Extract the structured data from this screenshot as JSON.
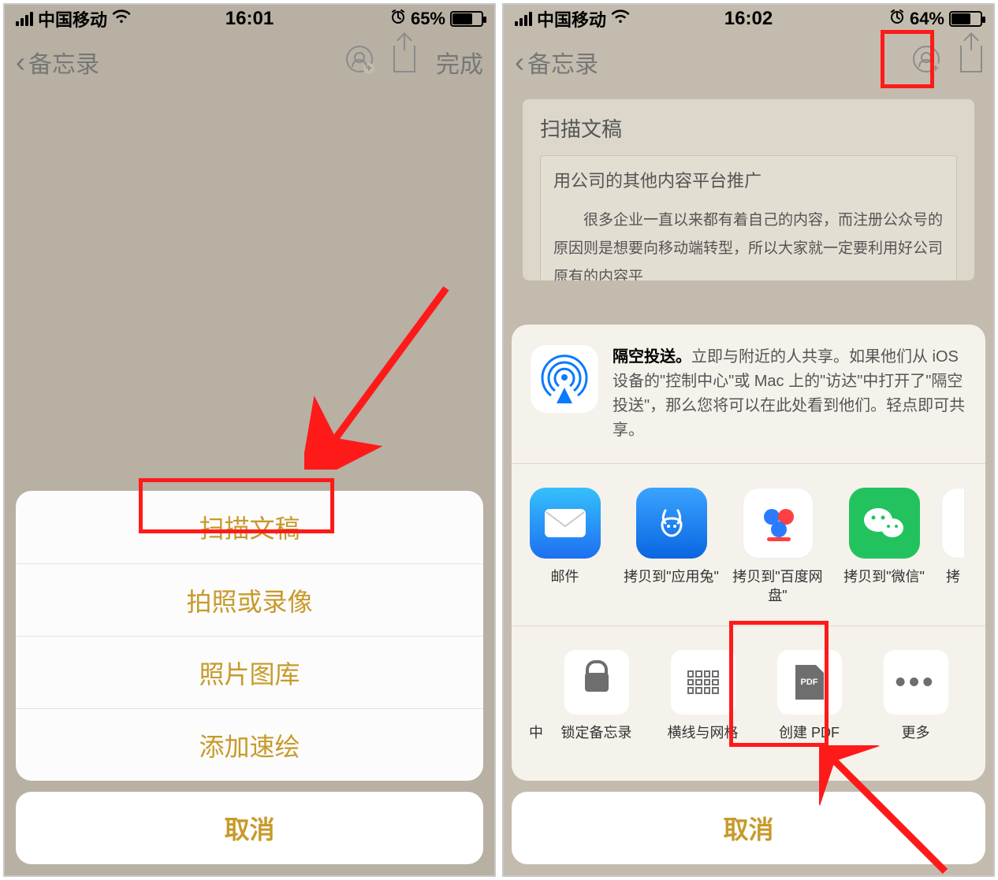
{
  "left": {
    "status": {
      "carrier": "中国移动",
      "time": "16:01",
      "battery_pct": "65%"
    },
    "nav": {
      "back": "备忘录",
      "done": "完成"
    },
    "sheet": {
      "items": [
        "扫描文稿",
        "拍照或录像",
        "照片图库",
        "添加速绘"
      ],
      "cancel": "取消"
    }
  },
  "right": {
    "status": {
      "carrier": "中国移动",
      "time": "16:02",
      "battery_pct": "64%"
    },
    "nav": {
      "back": "备忘录"
    },
    "doc": {
      "title": "扫描文稿",
      "inner_title": "用公司的其他内容平台推广",
      "body": "很多企业一直以来都有着自己的内容，而注册公众号的原因则是想要向移动端转型，所以大家就一定要利用好公司原有的内容平"
    },
    "share": {
      "airdrop_bold": "隔空投送。",
      "airdrop_text": "立即与附近的人共享。如果他们从 iOS 设备的\"控制中心\"或 Mac 上的\"访达\"中打开了\"隔空投送\"，那么您将可以在此处看到他们。轻点即可共享。",
      "apps": [
        {
          "label": "邮件",
          "bg": "linear-gradient(180deg,#35c0fb,#1e6ff1)"
        },
        {
          "label": "拷贝到\"应用兔\"",
          "bg": "linear-gradient(180deg,#3aa3ff,#0a66e0)"
        },
        {
          "label": "拷贝到\"百度网盘\"",
          "bg": "#ffffff"
        },
        {
          "label": "拷贝到\"微信\"",
          "bg": "#22c35e"
        },
        {
          "label": "拷",
          "bg": "#fff"
        }
      ],
      "actions_leading": "中",
      "actions": [
        {
          "label": "锁定备忘录",
          "kind": "lock"
        },
        {
          "label": "横线与网格",
          "kind": "grid"
        },
        {
          "label": "创建 PDF",
          "kind": "pdf"
        },
        {
          "label": "更多",
          "kind": "more"
        }
      ],
      "cancel": "取消"
    }
  }
}
